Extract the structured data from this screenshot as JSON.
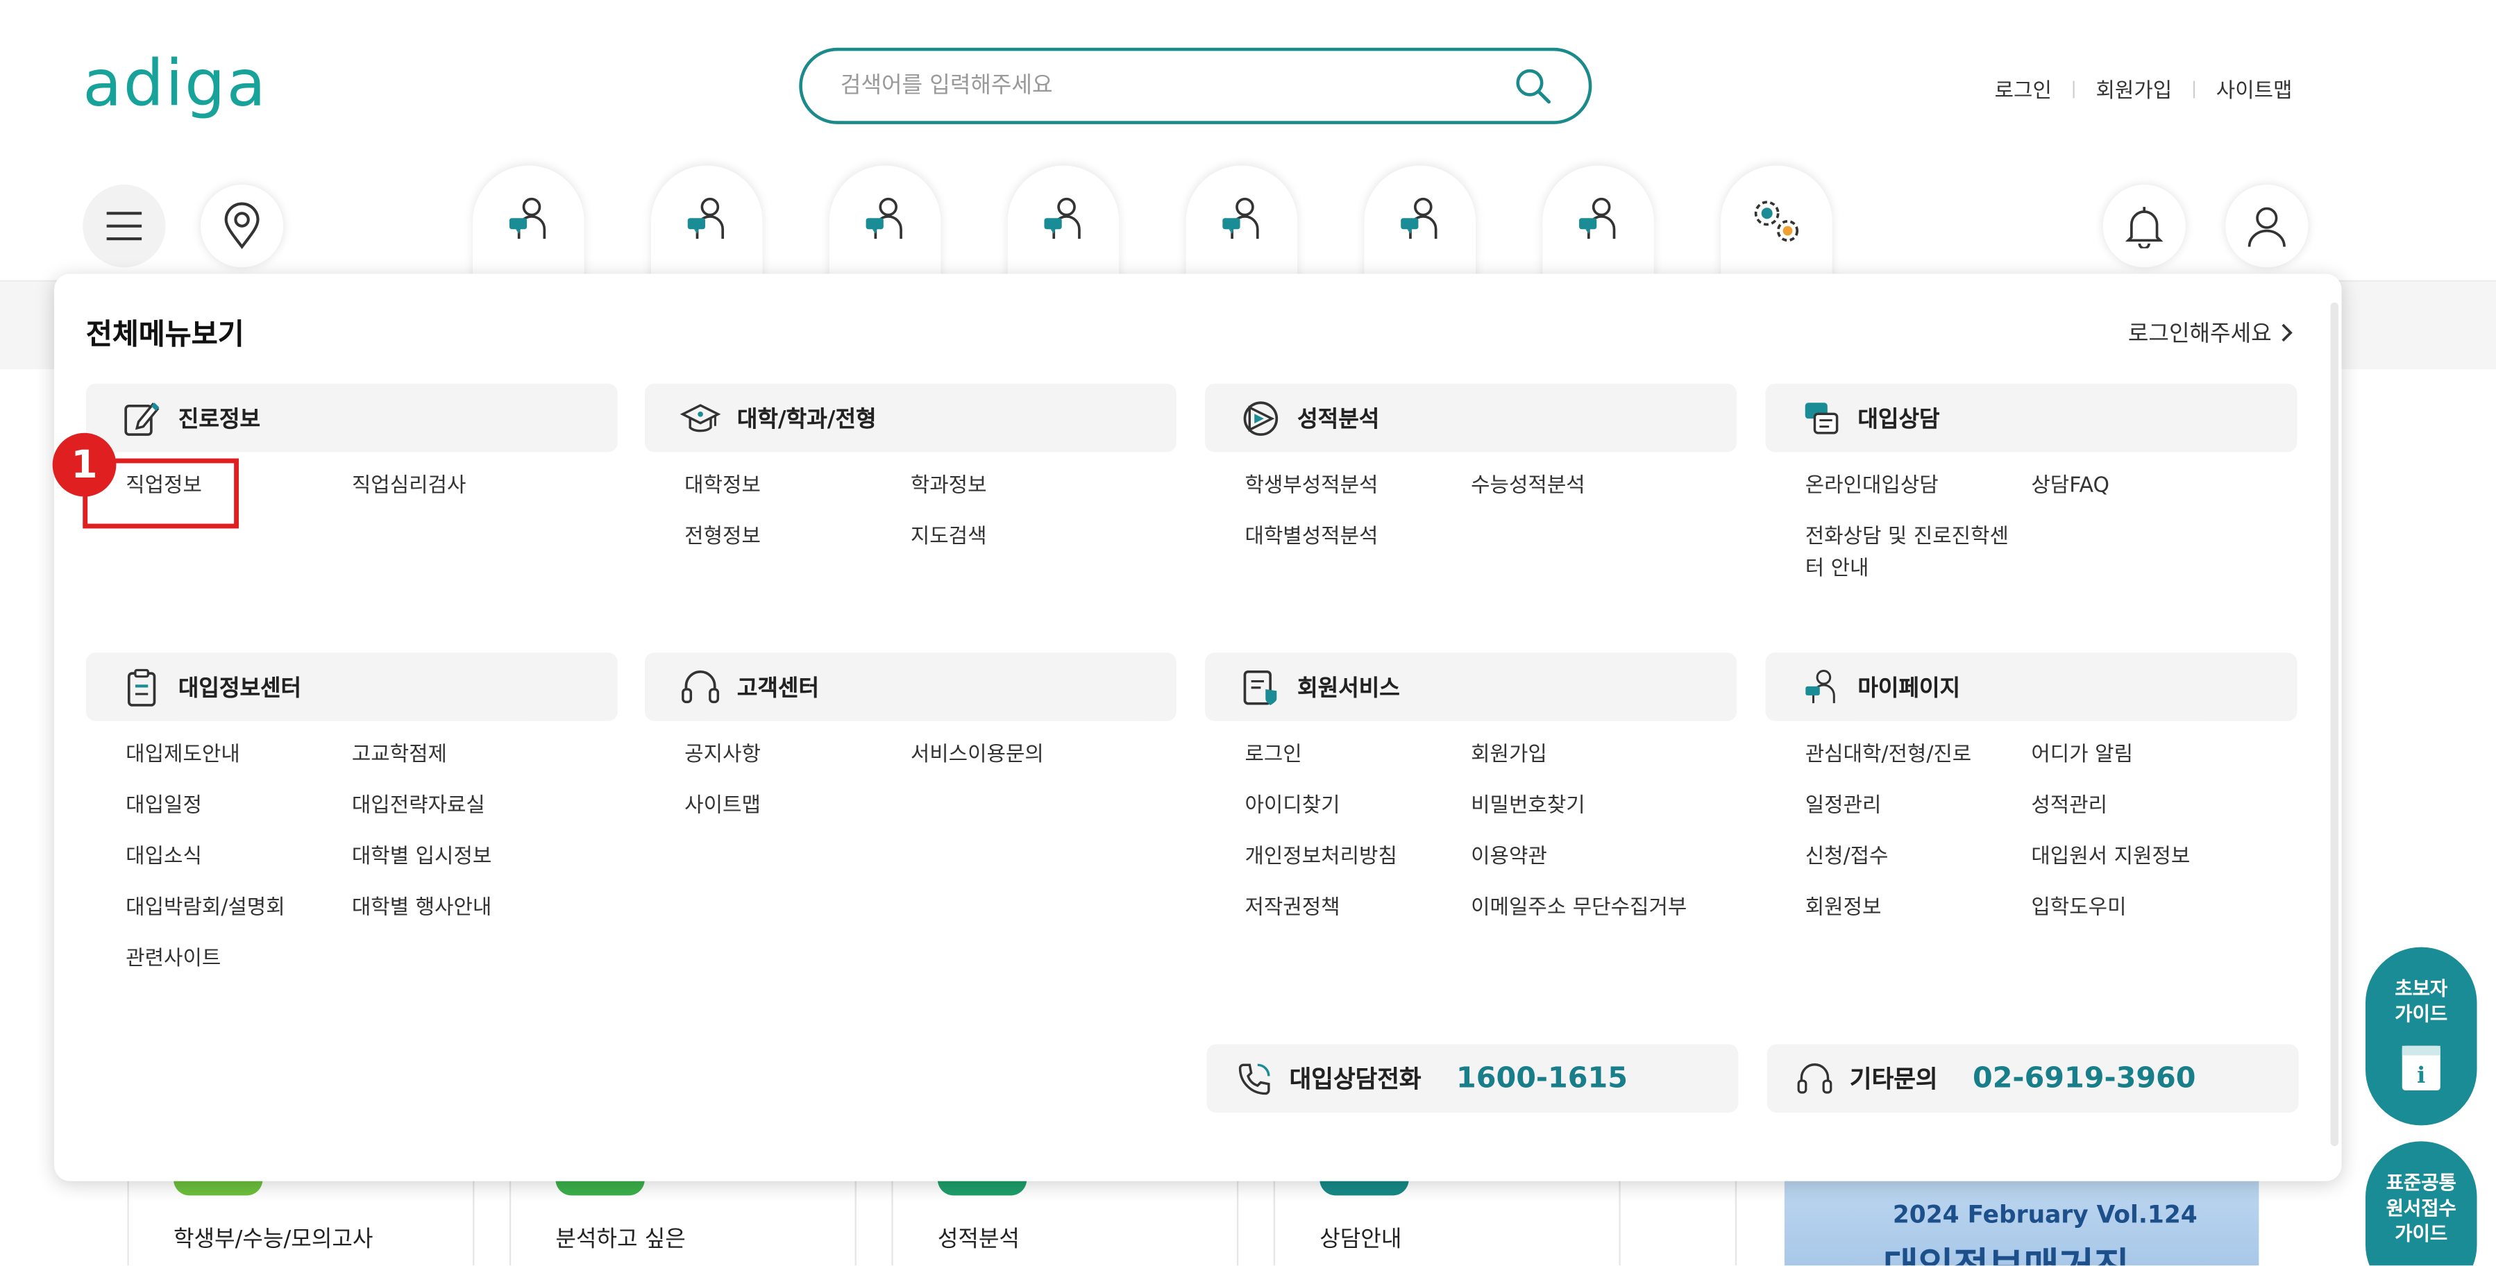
{
  "header": {
    "logo": "adiga",
    "search_placeholder": "검색어를 입력해주세요",
    "links": [
      "로그인",
      "회원가입",
      "사이트맵"
    ]
  },
  "nav": {
    "icons": [
      "menu-icon",
      "location-pin-icon",
      "counselor-icon",
      "counselor-icon",
      "counselor-icon",
      "counselor-icon",
      "counselor-icon",
      "counselor-icon",
      "counselor-icon",
      "settings-gears-icon",
      "bell-icon",
      "user-icon"
    ]
  },
  "menu": {
    "title": "전체메뉴보기",
    "login_prompt": "로그인해주세요",
    "annotation_number": "1",
    "sections": [
      {
        "title": "진로정보",
        "icon": "career-note-icon",
        "items": [
          "직업정보",
          "직업심리검사"
        ]
      },
      {
        "title": "대학/학과/전형",
        "icon": "graduation-cap-icon",
        "items": [
          "대학정보",
          "학과정보",
          "전형정보",
          "지도검색"
        ]
      },
      {
        "title": "성적분석",
        "icon": "score-analysis-icon",
        "items": [
          "학생부성적분석",
          "수능성적분석",
          "대학별성적분석"
        ]
      },
      {
        "title": "대입상담",
        "icon": "consult-chat-icon",
        "items": [
          "온라인대입상담",
          "상담FAQ",
          "전화상담 및 진로진학센터 안내"
        ]
      },
      {
        "title": "대입정보센터",
        "icon": "clipboard-icon",
        "items": [
          "대입제도안내",
          "고교학점제",
          "대입일정",
          "대입전략자료실",
          "대입소식",
          "대학별 입시정보",
          "대입박람회/설명회",
          "대학별 행사안내",
          "관련사이트"
        ]
      },
      {
        "title": "고객센터",
        "icon": "headset-icon",
        "items": [
          "공지사항",
          "서비스이용문의",
          "사이트맵"
        ]
      },
      {
        "title": "회원서비스",
        "icon": "member-doc-icon",
        "items": [
          "로그인",
          "회원가입",
          "아이디찾기",
          "비밀번호찾기",
          "개인정보처리방침",
          "이용약관",
          "저작권정책",
          "이메일주소 무단수집거부"
        ]
      },
      {
        "title": "마이페이지",
        "icon": "mypage-person-icon",
        "items": [
          "관심대학/전형/진로",
          "어디가 알림",
          "일정관리",
          "성적관리",
          "신청/접수",
          "대입원서 지원정보",
          "회원정보",
          "입학도우미"
        ]
      }
    ],
    "contacts": [
      {
        "label": "대입상담전화",
        "number": "1600-1615",
        "icon": "phone-icon"
      },
      {
        "label": "기타문의",
        "number": "02-6919-3960",
        "icon": "headset-icon"
      }
    ]
  },
  "background": {
    "cards": [
      "학생부/수능/모의고사",
      "분석하고 싶은",
      "성적분석",
      "상담안내"
    ],
    "banner_line1": "2024 February Vol.124",
    "banner_line2": "대입정보매거진"
  },
  "side": {
    "guide1": [
      "초보자",
      "가이드"
    ],
    "guide2": [
      "표준공통",
      "원서접수",
      "가이드"
    ]
  },
  "colors": {
    "brand": "#17a39a",
    "accent": "#177e8a",
    "highlight": "#e02020"
  }
}
